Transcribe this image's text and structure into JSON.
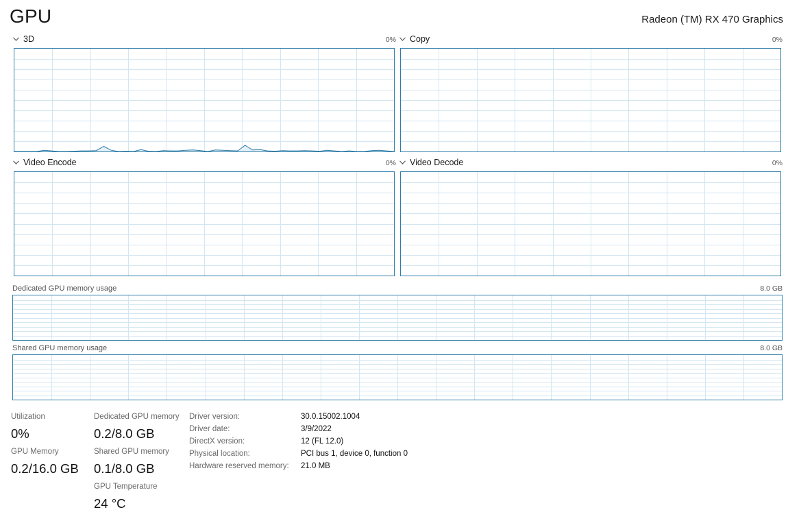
{
  "header": {
    "title": "GPU",
    "device": "Radeon (TM) RX 470 Graphics"
  },
  "graphs": [
    {
      "label": "3D",
      "max": "0%"
    },
    {
      "label": "Copy",
      "max": "0%"
    },
    {
      "label": "Video Encode",
      "max": "0%"
    },
    {
      "label": "Video Decode",
      "max": "0%"
    }
  ],
  "memory_graphs": [
    {
      "label": "Dedicated GPU memory usage",
      "max": "8.0 GB"
    },
    {
      "label": "Shared GPU memory usage",
      "max": "8.0 GB"
    }
  ],
  "stats": {
    "utilization": {
      "label": "Utilization",
      "value": "0%"
    },
    "gpu_memory": {
      "label": "GPU Memory",
      "value": "0.2/16.0 GB"
    },
    "dedicated": {
      "label": "Dedicated GPU memory",
      "value": "0.2/8.0 GB"
    },
    "shared": {
      "label": "Shared GPU memory",
      "value": "0.1/8.0 GB"
    },
    "temperature": {
      "label": "GPU Temperature",
      "value": "24 °C"
    }
  },
  "details": [
    {
      "label": "Driver version:",
      "value": "30.0.15002.1004"
    },
    {
      "label": "Driver date:",
      "value": "3/9/2022"
    },
    {
      "label": "DirectX version:",
      "value": "12 (FL 12.0)"
    },
    {
      "label": "Physical location:",
      "value": "PCI bus 1, device 0, function 0"
    },
    {
      "label": "Hardware reserved memory:",
      "value": "21.0 MB"
    }
  ],
  "colors": {
    "accent": "#2f7ca8",
    "grid": "#d3e6f1",
    "fill": "#e5f1f8"
  },
  "chart_data": {
    "type": "area",
    "series": [
      {
        "values": [
          0,
          0,
          0,
          0,
          1.2,
          0.6,
          0,
          0,
          0.3,
          0.6,
          0.6,
          0.9,
          5,
          1.2,
          0,
          0.3,
          0,
          1.8,
          0.3,
          0,
          0.9,
          0.6,
          0.6,
          1.2,
          1.5,
          0.9,
          0,
          1.5,
          1.2,
          0.9,
          0.6,
          6,
          1.5,
          1.8,
          0.6,
          0.3,
          0.9,
          0.6,
          0.6,
          0.9,
          0.6,
          0.3,
          1.2,
          0.6,
          0,
          0.6,
          0,
          0,
          0.9,
          1.2,
          0.6,
          0
        ]
      }
    ],
    "ylim": [
      0,
      100
    ],
    "grid": true
  }
}
